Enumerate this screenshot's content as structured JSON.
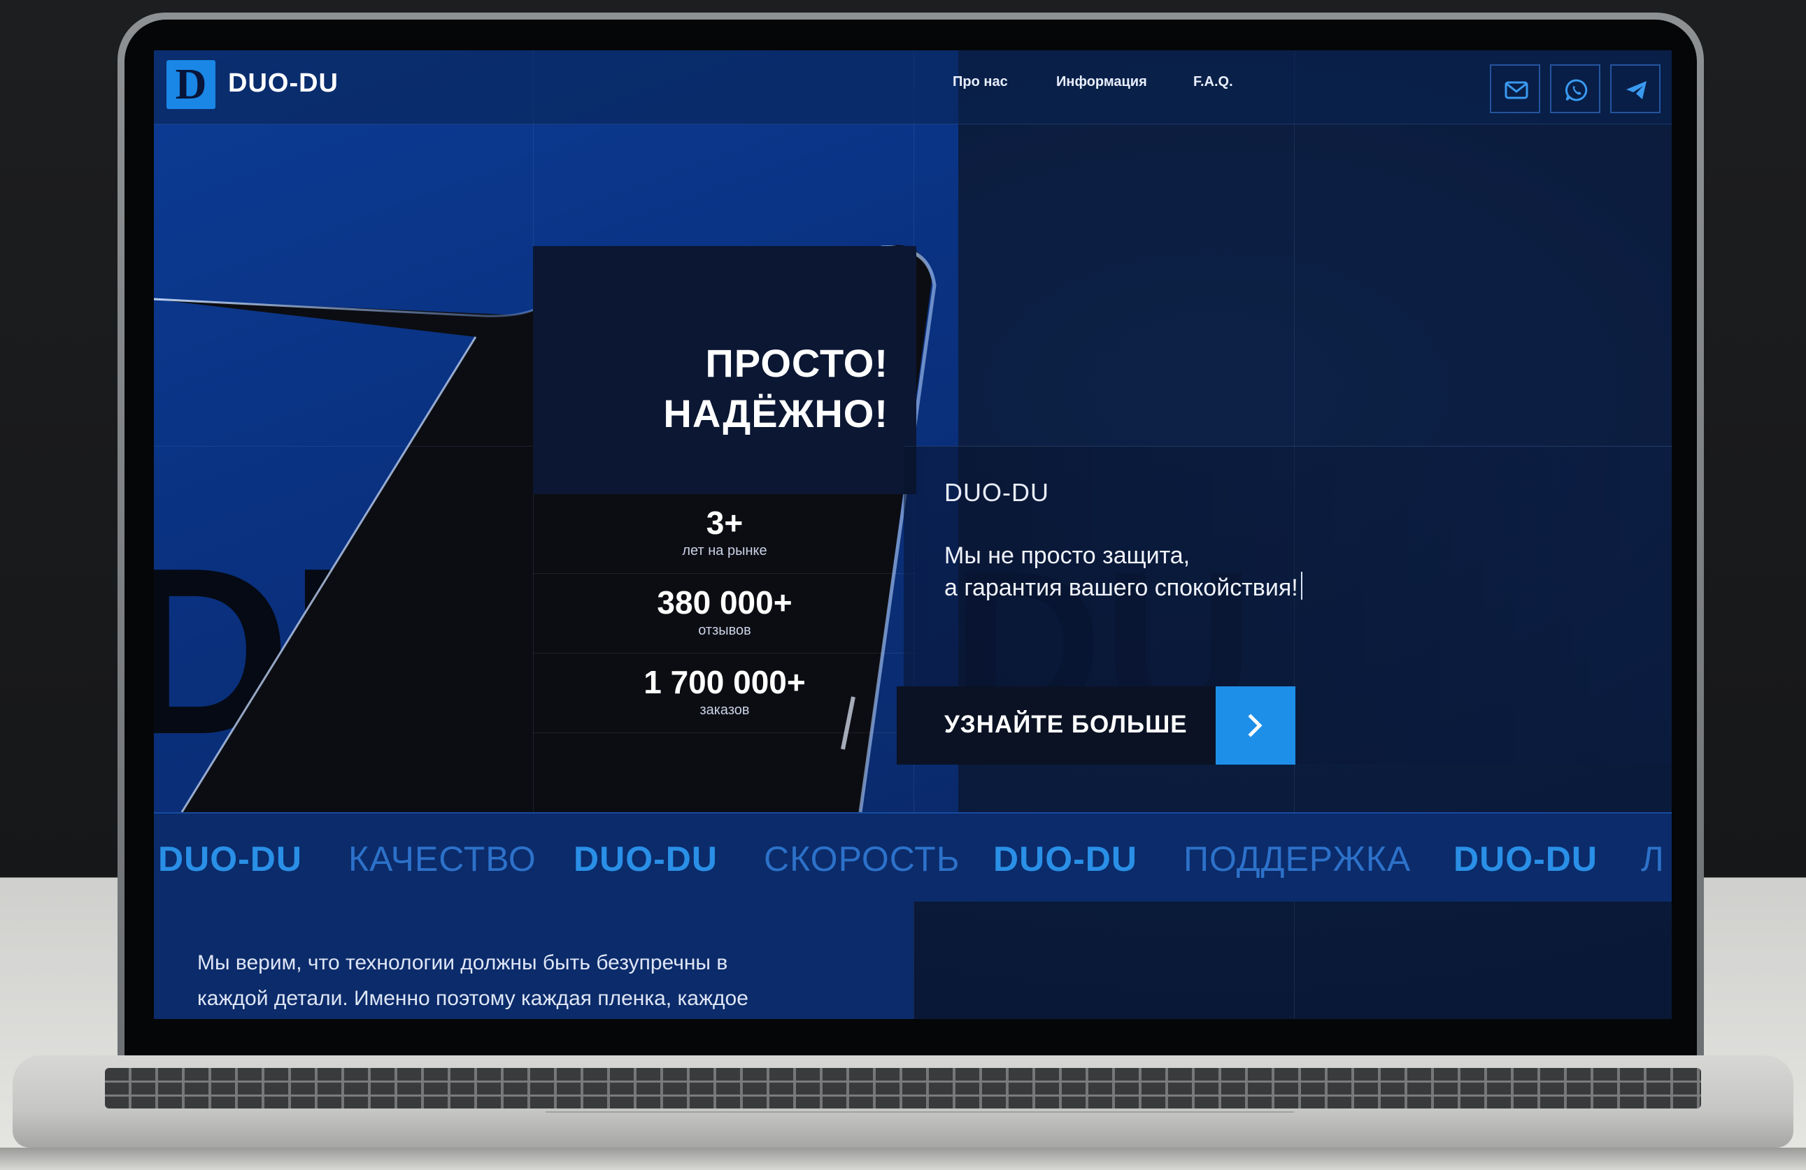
{
  "site": {
    "brand": "DUO-DU",
    "logo_letter": "D"
  },
  "nav": {
    "items": [
      "Про нас",
      "Информация",
      "F.A.Q."
    ]
  },
  "contact_icons": [
    "mail-icon",
    "whatsapp-icon",
    "telegram-icon"
  ],
  "hero": {
    "headline_line1": "ПРОСТО!",
    "headline_line2": "НАДЁЖНО!",
    "brand_label": "DUO-DU",
    "slogan_line1": "Мы не просто защита,",
    "slogan_line2": "а гарантия вашего спокойствия!",
    "cta_label": "УЗНАЙТЕ БОЛЬШЕ",
    "background_letters": "DU"
  },
  "stats": [
    {
      "value": "3+",
      "label": "лет на рынке"
    },
    {
      "value": "380 000+",
      "label": "отзывов"
    },
    {
      "value": "1 700 000+",
      "label": "заказов"
    }
  ],
  "marquee": [
    "DUO-DU",
    "КАЧЕСТВО",
    "DUO-DU",
    "СКОРОСТЬ",
    "DUO-DU",
    "ПОДДЕРЖКА",
    "DUO-DU",
    "Л"
  ],
  "about": {
    "line1": "Мы верим, что технологии должны быть безупречны в",
    "line2": "каждой детали. Именно поэтому каждая пленка, каждое"
  },
  "colors": {
    "accent": "#1d8fe8",
    "navy": "#0a1a3a",
    "marquee_bg": "#0b2b6a",
    "laptop_frame": "#8e9193"
  }
}
